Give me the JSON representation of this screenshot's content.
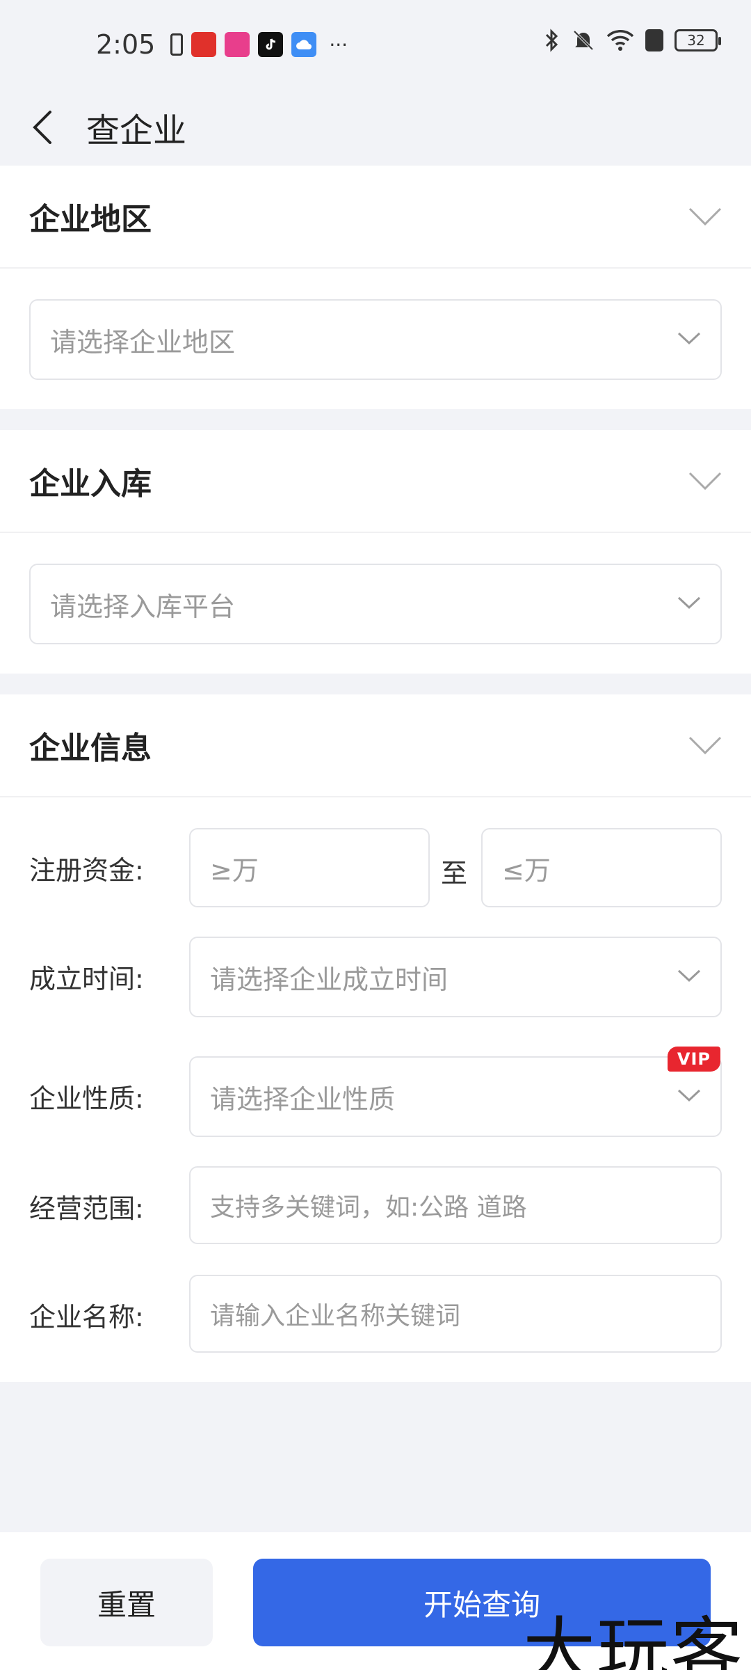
{
  "status_bar": {
    "time": "2:05",
    "more": "···",
    "battery": "32"
  },
  "header": {
    "title": "查企业"
  },
  "region": {
    "title": "企业地区",
    "placeholder": "请选择企业地区"
  },
  "storage": {
    "title": "企业入库",
    "placeholder": "请选择入库平台"
  },
  "info": {
    "title": "企业信息",
    "capital_label": "注册资金:",
    "capital_min_placeholder": "≥万",
    "capital_to": "至",
    "capital_max_placeholder": "≤万",
    "founded_label": "成立时间:",
    "founded_placeholder": "请选择企业成立时间",
    "nature_label": "企业性质:",
    "nature_placeholder": "请选择企业性质",
    "vip": "VIP",
    "scope_label": "经营范围:",
    "scope_placeholder": "支持多关键词，如:公路 道路",
    "name_label": "企业名称:",
    "name_placeholder": "请输入企业名称关键词"
  },
  "actions": {
    "reset": "重置",
    "search": "开始查询"
  },
  "watermark": "大玩客",
  "colors": {
    "primary": "#3468e6",
    "vip": "#e8262f",
    "background": "#f2f3f7"
  }
}
